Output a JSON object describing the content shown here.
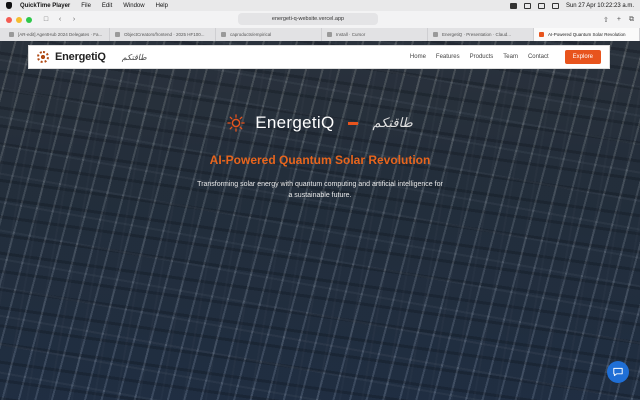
{
  "menubar": {
    "app": "QuickTime Player",
    "items": [
      "File",
      "Edit",
      "Window",
      "Help"
    ],
    "clock": "Sun 27 Apr  10:22:23 a.m."
  },
  "browser": {
    "url": "energeti-q-website.vercel.app",
    "tabs": [
      {
        "label": "[AR-edit] AgentHub 2024 Delegates · Fa...",
        "active": false
      },
      {
        "label": "ObjectCreators/frontend · 2025 HF100...",
        "active": false
      },
      {
        "label": "caproducts/empirical",
        "active": false
      },
      {
        "label": "Install · Cursor",
        "active": false
      },
      {
        "label": "EnergetiQ · Presentation · Claud...",
        "active": false
      },
      {
        "label": "AI-Powered Quantum Solar Revolution",
        "active": true
      }
    ]
  },
  "nav": {
    "brand": "EnergetiQ",
    "brand_arabic": "طاقتكم",
    "links": [
      "Home",
      "Features",
      "Products",
      "Team",
      "Contact"
    ],
    "cta": "Explore"
  },
  "hero": {
    "brand": "EnergetiQ",
    "brand_arabic": "طاقتكم",
    "headline": "AI-Powered Quantum Solar Revolution",
    "sub_line1": "Transforming solar energy with quantum computing and artificial intelligence for",
    "sub_line2": "a sustainable future."
  },
  "colors": {
    "accent": "#e8541d",
    "headline": "#e8651d",
    "chat": "#1f6fd6"
  },
  "icons": {
    "chat": "chat-bubble-icon",
    "logo": "sun-icon"
  }
}
